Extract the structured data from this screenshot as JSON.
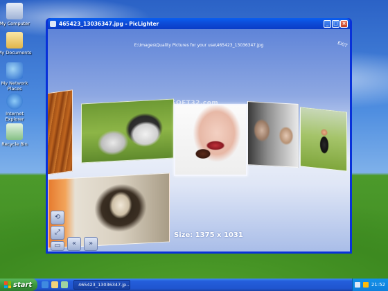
{
  "desktop": {
    "icons": [
      {
        "label": "My Computer",
        "icon": "my-computer-icon",
        "color": "#c8d4e8"
      },
      {
        "label": "My Documents",
        "icon": "my-documents-icon",
        "color": "#f3d37a"
      },
      {
        "label": "My Network Places",
        "icon": "network-places-icon",
        "color": "#6fa3e0"
      },
      {
        "label": "Internet Explorer",
        "icon": "internet-explorer-icon",
        "color": "#3f8ae0"
      },
      {
        "label": "Recycle Bin",
        "icon": "recycle-bin-icon",
        "color": "#9fd3a0"
      }
    ]
  },
  "window": {
    "title": "465423_13036347.jpg - PicLighter",
    "buttons": {
      "minimize": "_",
      "maximize": "□",
      "close": "×"
    }
  },
  "viewer": {
    "path": "E:\\Images\\Quality Pictures for your use\\465423_13036347.jpg",
    "exit_label": "EXIT",
    "watermark": "SOFT32.com",
    "size_text": "Size: 1375 x 1031",
    "photos": [
      {
        "name": "wood-photo",
        "desc": "wood"
      },
      {
        "name": "husky-photo",
        "desc": "husky"
      },
      {
        "name": "woman-lips-photo",
        "desc": "woman"
      },
      {
        "name": "men-portrait-photo",
        "desc": "men"
      },
      {
        "name": "golfer-photo",
        "desc": "golfer"
      },
      {
        "name": "woman-sepia-photo",
        "desc": "sepia"
      }
    ],
    "tools": [
      {
        "name": "rotate-tool-button",
        "glyph": "⟲"
      },
      {
        "name": "zoom-tool-button",
        "glyph": "⤢"
      },
      {
        "name": "fullscreen-tool-button",
        "glyph": "▭"
      },
      {
        "name": "prev-button",
        "glyph": "«"
      },
      {
        "name": "next-button",
        "glyph": "»"
      }
    ]
  },
  "taskbar": {
    "start_label": "start",
    "task_item": "465423_13036347.jp...",
    "clock": "21:52"
  }
}
